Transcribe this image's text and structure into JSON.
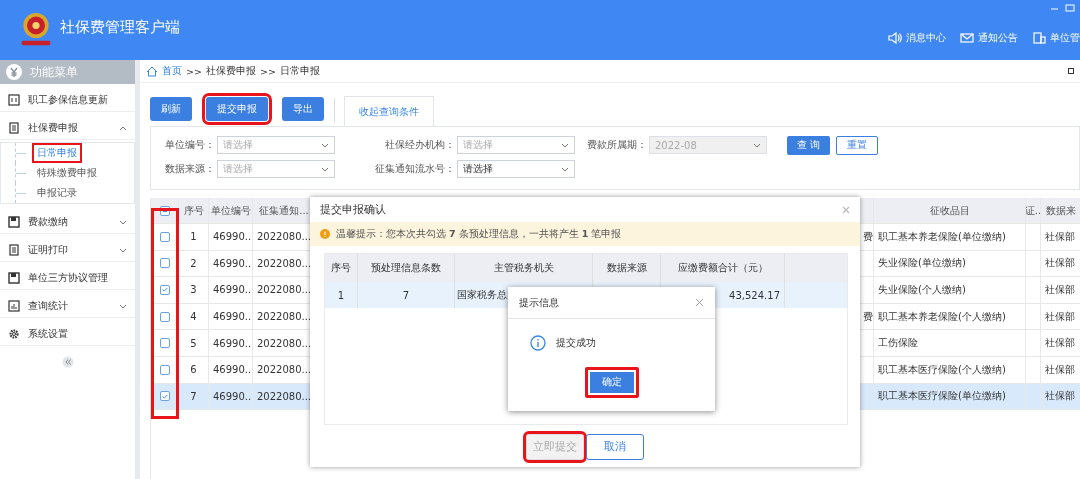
{
  "window": {
    "title": "社保费管理客户端"
  },
  "header_links": [
    {
      "label": "消息中心",
      "kind": "speaker"
    },
    {
      "label": "通知公告",
      "kind": "mail"
    },
    {
      "label": "单位管",
      "kind": "building"
    }
  ],
  "sidebar": {
    "title": "功能菜单",
    "items": [
      {
        "label": "职工参保信息更新",
        "kind": "card"
      },
      {
        "label": "社保费申报",
        "kind": "list",
        "expanded": true,
        "children": [
          {
            "label": "日常申报",
            "selected": true,
            "highlighted": true
          },
          {
            "label": "特殊缴费申报",
            "selected": false,
            "highlighted": false
          },
          {
            "label": "申报记录",
            "selected": false,
            "highlighted": false
          }
        ]
      },
      {
        "label": "费款缴纳",
        "kind": "save",
        "expanded": false
      },
      {
        "label": "证明打印",
        "kind": "list",
        "expanded": false
      },
      {
        "label": "单位三方协议管理",
        "kind": "save"
      },
      {
        "label": "查询统计",
        "kind": "chart",
        "expanded": false
      },
      {
        "label": "系统设置",
        "kind": "gear"
      }
    ]
  },
  "breadcrumb": {
    "separator": ">>",
    "items": [
      "首页",
      "社保费申报",
      "日常申报"
    ]
  },
  "toolbar": {
    "buttons": [
      {
        "label": "刷新",
        "highlighted": false
      },
      {
        "label": "提交申报",
        "highlighted": true
      },
      {
        "label": "导出",
        "highlighted": false
      }
    ],
    "tab": "收起查询条件"
  },
  "filters": [
    {
      "label": "单位编号：",
      "placeholder": "请选择",
      "disabled": false
    },
    {
      "label": "社保经办机构：",
      "placeholder": "请选择",
      "disabled": false
    },
    {
      "label": "费款所属期：",
      "value": "2022-08",
      "disabled": true
    },
    {
      "label": "数据来源：",
      "placeholder": "请选择",
      "disabled": false
    },
    {
      "label": "征集通知流水号：",
      "value": "请选择",
      "disabled": false
    }
  ],
  "filter_buttons": [
    {
      "label": "查 询",
      "kind": "primary"
    },
    {
      "label": "重置",
      "kind": "outline"
    }
  ],
  "table": {
    "checkbox_column_highlighted": true,
    "header_checkbox_indeterminate": true,
    "columns": [
      {
        "label": "序号"
      },
      {
        "label": "单位编号"
      },
      {
        "label": "征集通知..."
      },
      {},
      {
        "label": "征收品目"
      },
      {
        "label": "证.."
      },
      {
        "label": "数据来"
      }
    ],
    "rows": [
      {
        "checked": false,
        "selected": false,
        "cells": [
          "1",
          "46990...",
          "2022080...",
          "费",
          "职工基本养老保险(单位缴纳)",
          null,
          "社保部"
        ]
      },
      {
        "checked": false,
        "selected": false,
        "cells": [
          "2",
          "46990...",
          "2022080...",
          null,
          "失业保险(单位缴纳)",
          null,
          "社保部"
        ]
      },
      {
        "checked": true,
        "selected": false,
        "cells": [
          "3",
          "46990...",
          "2022080...",
          null,
          "失业保险(个人缴纳)",
          null,
          "社保部"
        ]
      },
      {
        "checked": false,
        "selected": false,
        "cells": [
          "4",
          "46990...",
          "2022080...",
          "费",
          "职工基本养老保险(个人缴纳)",
          null,
          "社保部"
        ]
      },
      {
        "checked": false,
        "selected": false,
        "cells": [
          "5",
          "46990...",
          "2022080...",
          null,
          "工伤保险",
          null,
          "社保部"
        ]
      },
      {
        "checked": false,
        "selected": false,
        "cells": [
          "6",
          "46990...",
          "2022080...",
          null,
          "职工基本医疗保险(个人缴纳)",
          null,
          "社保部"
        ]
      },
      {
        "checked": true,
        "selected": true,
        "cells": [
          "7",
          "46990...",
          "2022080...",
          null,
          "职工基本医疗保险(单位缴纳)",
          null,
          "社保部"
        ]
      }
    ]
  },
  "dialog": {
    "title": "提交申报确认",
    "notice": "温馨提示：您本次共勾选 **7** 条预处理信息，一共将产生 **1** 笔申报",
    "columns": [
      "序号",
      "预处理信息条数",
      "主管税务机关",
      "数据来源",
      "应缴费额合计（元）"
    ],
    "rows": [
      {
        "cells": [
          "1",
          "7",
          "国家税务总",
          null,
          "43,524.17"
        ]
      }
    ],
    "buttons": [
      {
        "label": "立即提交",
        "kind": "submit",
        "disabled": true,
        "highlighted": true
      },
      {
        "label": "取消",
        "kind": "cancel",
        "disabled": false,
        "highlighted": false
      }
    ]
  },
  "alert": {
    "title": "提示信息",
    "message": "提交成功",
    "button": {
      "label": "确定",
      "highlighted": true
    }
  }
}
